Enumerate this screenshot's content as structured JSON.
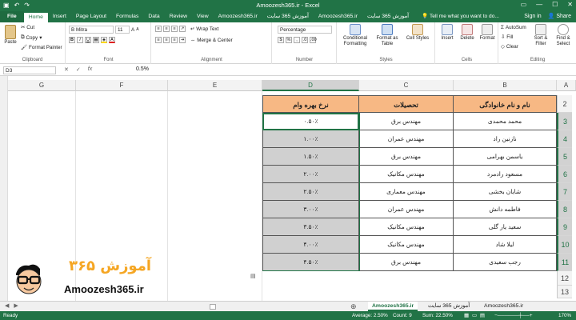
{
  "titlebar": {
    "title": "Amoozesh365.ir - Excel",
    "save_icon": "save-icon",
    "undo_icon": "undo-icon",
    "redo_icon": "redo-icon"
  },
  "tabs": [
    "File",
    "Home",
    "Insert",
    "Page Layout",
    "Formulas",
    "Data",
    "Review",
    "View",
    "Amoozesh365.ir",
    "آموزش 365 سایت",
    "Amoozesh365.ir",
    "آموزش 365 سایت"
  ],
  "tell_me": "Tell me what you want to do...",
  "account": {
    "signin": "Sign in",
    "share": "Share"
  },
  "ribbon": {
    "clipboard": {
      "paste": "Paste",
      "cut": "Cut",
      "copy": "Copy",
      "format_painter": "Format Painter",
      "label": "Clipboard"
    },
    "font": {
      "name": "B Mitra",
      "size": "11",
      "label": "Font"
    },
    "alignment": {
      "wrap_text": "Wrap Text",
      "merge_center": "Merge & Center",
      "label": "Alignment"
    },
    "number": {
      "format": "Percentage",
      "label": "Number"
    },
    "styles": {
      "conditional": "Conditional Formatting",
      "format_table": "Format as Table",
      "cell_styles": "Cell Styles",
      "label": "Styles"
    },
    "cells": {
      "insert": "Insert",
      "delete": "Delete",
      "format": "Format",
      "label": "Cells"
    },
    "editing": {
      "autosum": "AutoSum",
      "fill": "Fill",
      "clear": "Clear",
      "sort_filter": "Sort & Filter",
      "find_select": "Find & Select",
      "label": "Editing"
    }
  },
  "formula_bar": {
    "name_box": "D3",
    "fx": "fx",
    "value": "0.5%"
  },
  "columns": [
    "G",
    "F",
    "E",
    "D",
    "C",
    "B",
    "A"
  ],
  "rows": [
    "2",
    "3",
    "4",
    "5",
    "6",
    "7",
    "8",
    "9",
    "10",
    "11",
    "12",
    "13"
  ],
  "table": {
    "headers": [
      "نام و نام خانوادگی",
      "تحصیلات",
      "نرخ بهره وام"
    ],
    "rows": [
      [
        "محمد محمدی",
        "مهندس برق",
        "۰.۵۰٪"
      ],
      [
        "نازنین راد",
        "مهندس عمران",
        "۱.۰۰٪"
      ],
      [
        "یاسمن بهرامی",
        "مهندس برق",
        "۱.۵۰٪"
      ],
      [
        "مسعود رادمرد",
        "مهندس مکانیک",
        "۲.۰۰٪"
      ],
      [
        "شایان بخشی",
        "مهندس معماری",
        "۲.۵۰٪"
      ],
      [
        "فاطمه دانش",
        "مهندس عمران",
        "۳.۰۰٪"
      ],
      [
        "سعید یار گلی",
        "مهندس مکانیک",
        "۳.۵۰٪"
      ],
      [
        "لیلا شاد",
        "مهندس مکانیک",
        "۴.۰۰٪"
      ],
      [
        "رجب سعیدی",
        "مهندس برق",
        "۴.۵۰٪"
      ]
    ]
  },
  "sheets": [
    "Amoozesh365.ir",
    "آموزش 365 سایت",
    "Amoozesh365.ir"
  ],
  "status": {
    "ready": "Ready",
    "average": "Average: 2.50%",
    "count": "Count: 9",
    "sum": "Sum: 22.50%",
    "zoom": "170%"
  },
  "logo": {
    "text": "Amoozesh365.ir",
    "persian": "آموزش ۳۶۵"
  },
  "colors": {
    "excel_green": "#217346",
    "header_fill": "#f7b884",
    "selection_fill": "#d0d0d0"
  }
}
